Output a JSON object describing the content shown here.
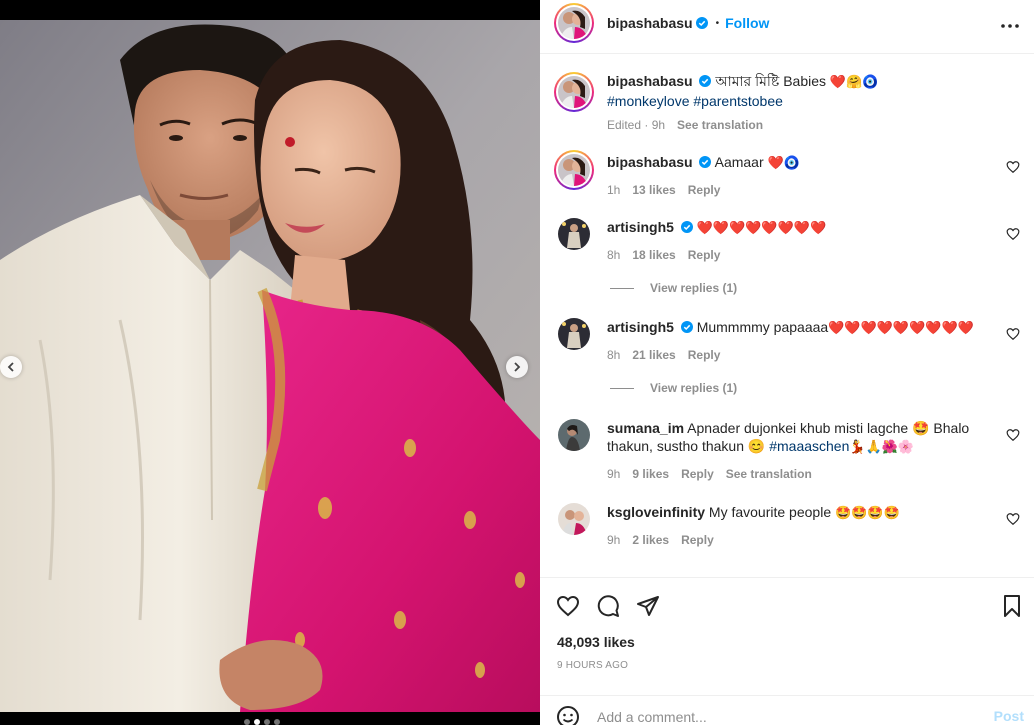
{
  "header": {
    "username": "bipashabasu",
    "separator": "•",
    "follow_label": "Follow",
    "more_icon": "more-horizontal-icon"
  },
  "caption": {
    "username": "bipashabasu",
    "text": "আমার মিষ্টি Babies",
    "emojis": "❤️🤗🧿",
    "hashtags": [
      "#monkeylove",
      "#parentstobee"
    ],
    "edited": "Edited · 9h",
    "see_translation": "See translation"
  },
  "comments": [
    {
      "username": "bipashabasu",
      "verified": true,
      "text": "Aamaar",
      "emojis": "❤️🧿",
      "time": "1h",
      "likes": "13 likes",
      "reply": "Reply",
      "view_replies": ""
    },
    {
      "username": "artisingh5",
      "verified": true,
      "text": "",
      "emojis": "❤️❤️❤️❤️❤️❤️❤️❤️",
      "time": "8h",
      "likes": "18 likes",
      "reply": "Reply",
      "view_replies": "View replies (1)"
    },
    {
      "username": "artisingh5",
      "verified": true,
      "text": "Mummmmy papaaaa",
      "emojis": "❤️❤️❤️❤️❤️❤️❤️❤️❤️",
      "time": "8h",
      "likes": "21 likes",
      "reply": "Reply",
      "view_replies": "View replies (1)"
    },
    {
      "username": "sumana_im",
      "verified": false,
      "text": "Apnader dujonkei khub misti lagche 🤩 Bhalo thakun, sustho thakun 😊",
      "hashtag": "#maaaschen",
      "emojis": "💃🙏🌺🌸",
      "time": "9h",
      "likes": "9 likes",
      "reply": "Reply",
      "see_translation": "See translation"
    },
    {
      "username": "ksgloveinfinity",
      "verified": false,
      "text": "My favourite people",
      "emojis": "🤩🤩🤩🤩",
      "time": "9h",
      "likes": "2 likes",
      "reply": "Reply"
    }
  ],
  "actions": {
    "like_icon": "heart-icon",
    "comment_icon": "comment-bubble-icon",
    "share_icon": "paper-plane-icon",
    "save_icon": "bookmark-icon"
  },
  "likes": "48,093 likes",
  "timestamp": "9 HOURS AGO",
  "add_comment": {
    "placeholder": "Add a comment...",
    "post_label": "Post"
  },
  "carousel": {
    "total": 4,
    "active": 2
  },
  "colors": {
    "accent": "#0095f6",
    "hashtag": "#00376b",
    "muted": "#8e8e8e",
    "heart": "#ed1c24",
    "saree": "#e0157a"
  }
}
